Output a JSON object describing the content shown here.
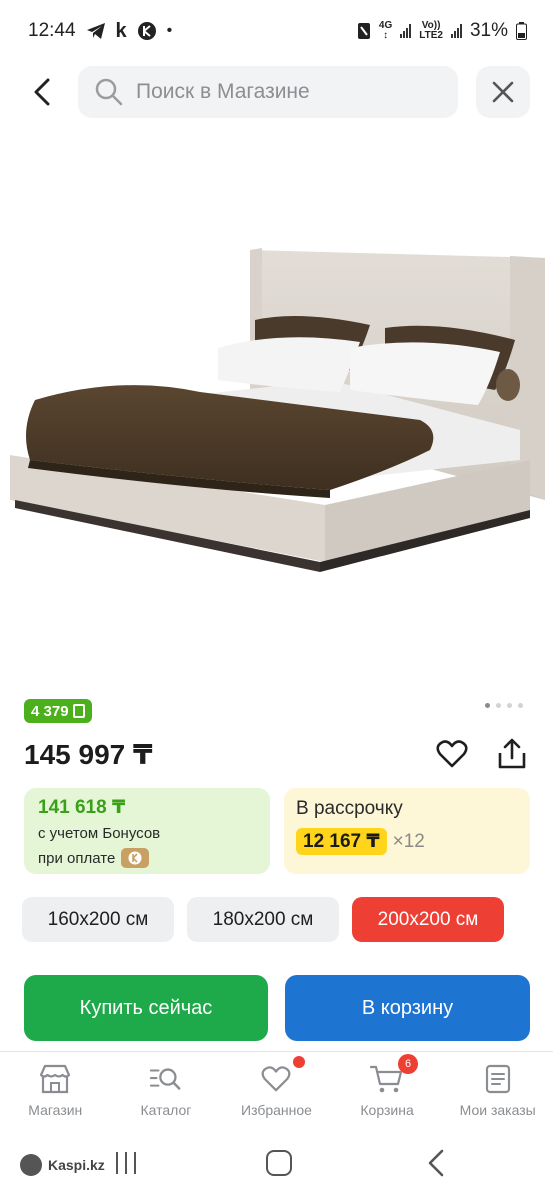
{
  "status_bar": {
    "time": "12:44",
    "battery": "31%",
    "net_4g": "4G",
    "volte_top": "Vo))",
    "volte_bottom": "LTE2"
  },
  "search": {
    "placeholder": "Поиск в Магазине"
  },
  "product": {
    "bonus_badge": "4 379",
    "price": "145 997 ₸",
    "image_count": 4,
    "active_image": 1
  },
  "bonus_card": {
    "amount": "141 618 ₸",
    "line1": "с учетом Бонусов",
    "line2": "при оплате"
  },
  "installment_card": {
    "title": "В рассрочку",
    "monthly": "12 167 ₸",
    "months": "×12"
  },
  "sizes": [
    {
      "label": "160x200 см",
      "selected": false
    },
    {
      "label": "180x200 см",
      "selected": false
    },
    {
      "label": "200x200 см",
      "selected": true
    }
  ],
  "actions": {
    "buy_now": "Купить сейчас",
    "add_to_cart": "В корзину"
  },
  "tabbar": [
    {
      "label": "Магазин",
      "icon": "shop-icon"
    },
    {
      "label": "Каталог",
      "icon": "catalog-search-icon"
    },
    {
      "label": "Избранное",
      "icon": "heart-icon",
      "dot": true
    },
    {
      "label": "Корзина",
      "icon": "cart-icon",
      "badge": "6"
    },
    {
      "label": "Мои заказы",
      "icon": "orders-icon"
    }
  ],
  "system_nav": {
    "app_label": "Kaspi.kz"
  },
  "colors": {
    "bonus_green": "#4caf1c",
    "buy_green": "#1ea94a",
    "cart_blue": "#1d74d1",
    "selected_red": "#ee3f34",
    "installment_yellow": "#ffd51c"
  }
}
